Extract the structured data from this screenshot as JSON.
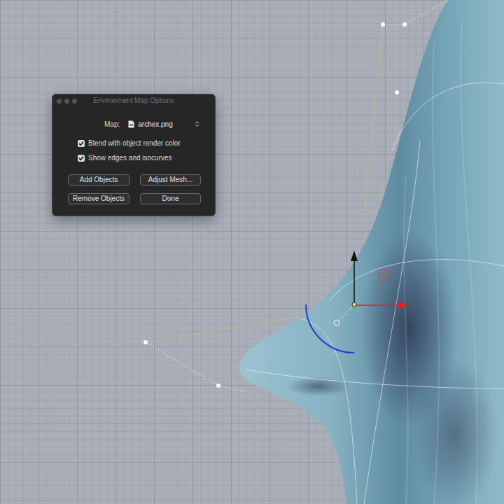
{
  "window": {
    "title": "Environment Map Options"
  },
  "map": {
    "label": "Map:",
    "value": "archex.png"
  },
  "options": [
    {
      "label": "Blend with object render color",
      "checked": true
    },
    {
      "label": "Show edges and isocurves",
      "checked": true
    }
  ],
  "buttons": [
    "Add Objects",
    "Adjust Mesh...",
    "Remove Objects",
    "Done"
  ]
}
